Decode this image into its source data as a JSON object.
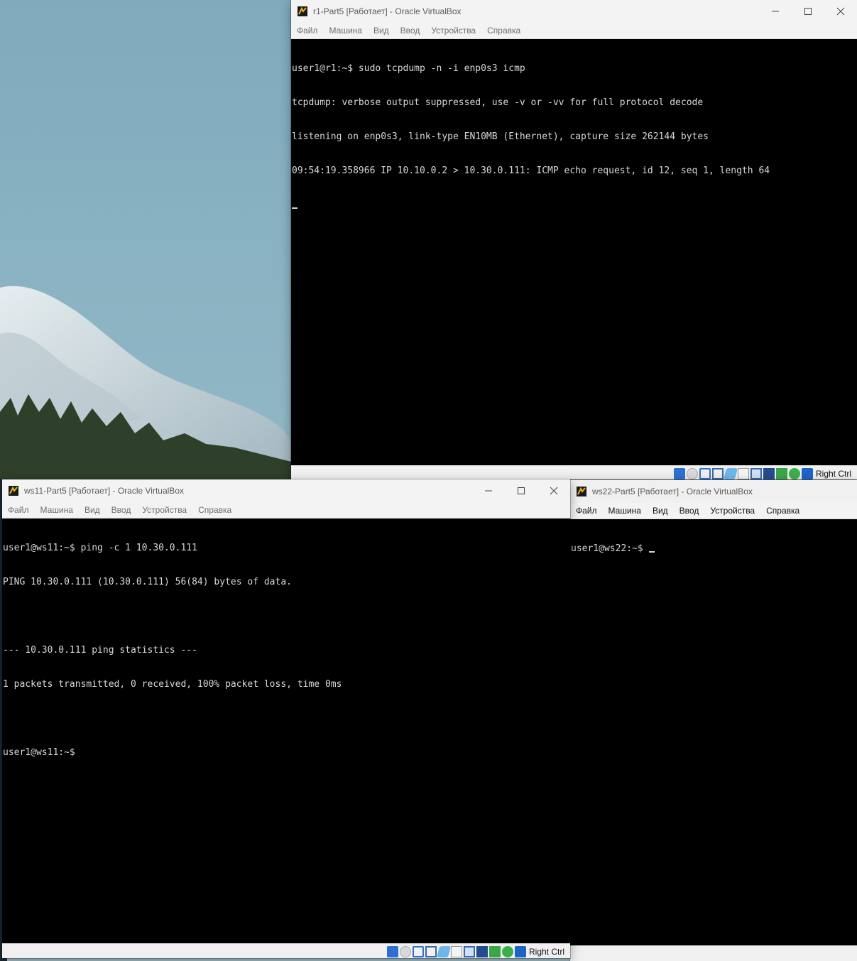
{
  "windows": {
    "r1": {
      "title": "r1-Part5 [Работает] - Oracle VirtualBox",
      "menu": [
        "Файл",
        "Машина",
        "Вид",
        "Ввод",
        "Устройства",
        "Справка"
      ],
      "terminal": [
        "user1@r1:~$ sudo tcpdump -n -i enp0s3 icmp",
        "tcpdump: verbose output suppressed, use -v or -vv for full protocol decode",
        "listening on enp0s3, link-type EN10MB (Ethernet), capture size 262144 bytes",
        "09:54:19.358966 IP 10.10.0.2 > 10.30.0.111: ICMP echo request, id 12, seq 1, length 64"
      ],
      "host_key": "Right Ctrl"
    },
    "ws11": {
      "title": "ws11-Part5 [Работает] - Oracle VirtualBox",
      "menu": [
        "Файл",
        "Машина",
        "Вид",
        "Ввод",
        "Устройства",
        "Справка"
      ],
      "terminal": [
        "user1@ws11:~$ ping -c 1 10.30.0.111",
        "PING 10.30.0.111 (10.30.0.111) 56(84) bytes of data.",
        "",
        "--- 10.30.0.111 ping statistics ---",
        "1 packets transmitted, 0 received, 100% packet loss, time 0ms",
        "",
        "user1@ws11:~$"
      ],
      "host_key": "Right Ctrl"
    },
    "ws22": {
      "title": "ws22-Part5 [Работает] - Oracle VirtualBox",
      "menu": [
        "Файл",
        "Машина",
        "Вид",
        "Ввод",
        "Устройства",
        "Справка"
      ],
      "terminal": [
        "user1@ws22:~$ "
      ]
    }
  },
  "icons": {
    "window_controls": [
      "minimize-icon",
      "maximize-icon",
      "close-icon"
    ],
    "status_bar": [
      "hard-disk-icon",
      "optical-drive-icon",
      "audio-icon",
      "network-icon",
      "usb-icon",
      "shared-folders-icon",
      "display-icon",
      "video-capture-icon",
      "mouse-integration-icon",
      "recording-icon",
      "keyboard-capture-icon"
    ]
  },
  "colors": {
    "terminal_bg": "#000000",
    "terminal_fg": "#d8d8d8",
    "titlebar": "#f3f3f3"
  }
}
